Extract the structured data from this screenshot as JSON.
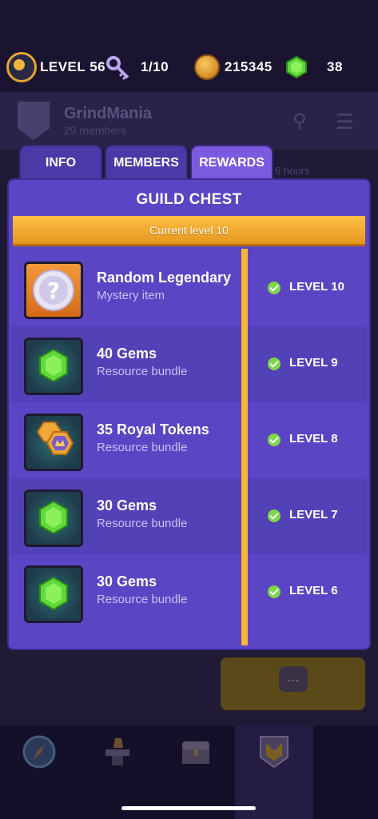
{
  "topbar": {
    "level_label": "LEVEL 56",
    "keys": "1/10",
    "coins": "215345",
    "gems": "38"
  },
  "guild": {
    "name": "GrindMania",
    "members": "29 members",
    "background_timer_fragment": "6 hours"
  },
  "tabs": [
    {
      "label": "INFO"
    },
    {
      "label": "MEMBERS"
    },
    {
      "label": "REWARDS"
    }
  ],
  "panel": {
    "title": "GUILD CHEST",
    "banner": "Current level 10",
    "rewards": [
      {
        "name": "Random Legendary",
        "subtitle": "Mystery item",
        "level": "LEVEL 10",
        "icon": "mystery-orb-icon",
        "claimed": true
      },
      {
        "name": "40 Gems",
        "subtitle": "Resource bundle",
        "level": "LEVEL 9",
        "icon": "gem-icon",
        "claimed": true
      },
      {
        "name": "35 Royal Tokens",
        "subtitle": "Resource bundle",
        "level": "LEVEL 8",
        "icon": "royal-token-icon",
        "claimed": true
      },
      {
        "name": "30 Gems",
        "subtitle": "Resource bundle",
        "level": "LEVEL 7",
        "icon": "gem-icon",
        "claimed": true
      },
      {
        "name": "30 Gems",
        "subtitle": "Resource bundle",
        "level": "LEVEL 6",
        "icon": "gem-icon",
        "claimed": true
      }
    ]
  },
  "chat": {
    "icon_text": "..."
  },
  "colors": {
    "panel": "#5b45c4",
    "tab_active": "#7b5ae0",
    "banner": "#f5b832",
    "check": "#7cd84a"
  },
  "nav": [
    {
      "icon": "compass-icon"
    },
    {
      "icon": "anvil-icon"
    },
    {
      "icon": "chest-icon"
    },
    {
      "icon": "guild-shield-icon",
      "active": true
    }
  ]
}
